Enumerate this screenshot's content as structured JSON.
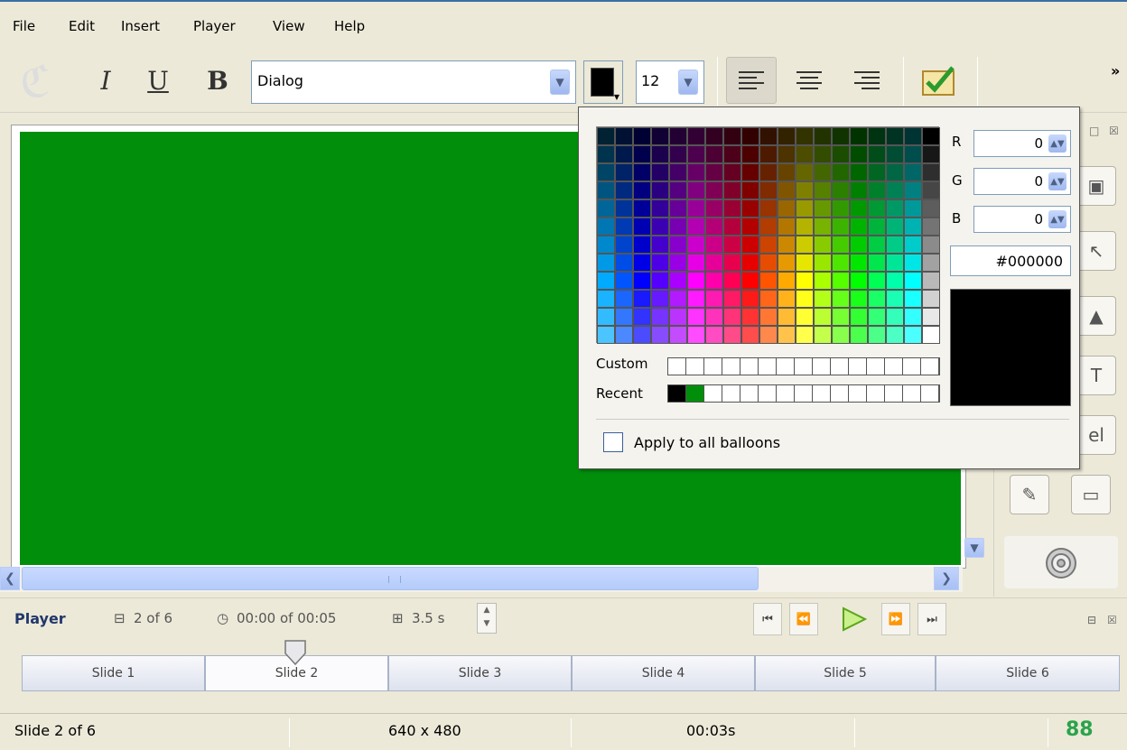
{
  "menu": [
    "File",
    "Edit",
    "Insert",
    "Player",
    "View",
    "Help"
  ],
  "toolbar": {
    "italic": "I",
    "underline": "U",
    "bold": "B",
    "font_name": "Dialog",
    "font_size": "12",
    "overflow": "»",
    "text_color": "#000000"
  },
  "stage": {
    "background": "#008e0b"
  },
  "player": {
    "label": "Player",
    "slide_position": "2 of 6",
    "time": "00:00 of 00:05",
    "duration": "3.5 s"
  },
  "slides": [
    "Slide 1",
    "Slide 2",
    "Slide 3",
    "Slide 4",
    "Slide 5",
    "Slide 6"
  ],
  "status": {
    "slide": "Slide 2 of 6",
    "size": "640 x 480",
    "time": "00:03s"
  },
  "color_picker": {
    "r_label": "R",
    "g_label": "G",
    "b_label": "B",
    "r_value": "0",
    "g_value": "0",
    "b_value": "0",
    "hex": "#000000",
    "custom_label": "Custom",
    "recent_label": "Recent",
    "recent_colors": [
      "#000000",
      "#008e0b"
    ],
    "apply_label": "Apply to all balloons",
    "apply_checked": false
  }
}
